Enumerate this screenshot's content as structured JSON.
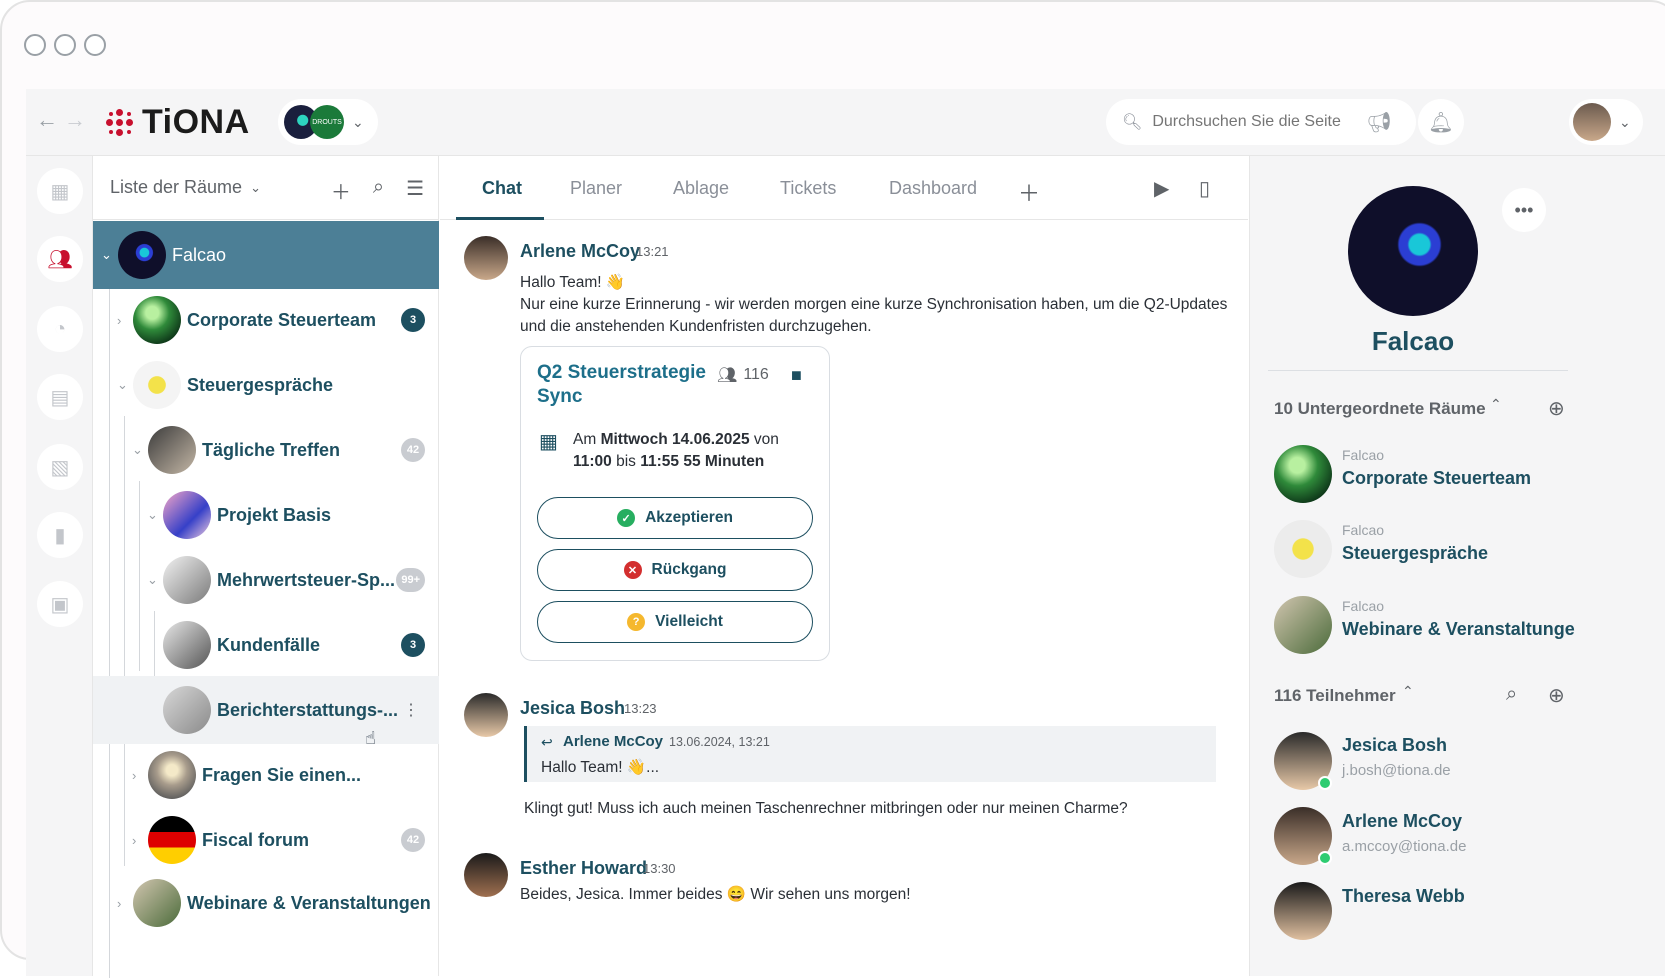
{
  "app": {
    "logo": "TiONA",
    "org_badge": "DROUTS"
  },
  "search": {
    "placeholder": "Durchsuchen Sie die Seite"
  },
  "roomlist": {
    "title": "Liste der Räume",
    "rooms": [
      {
        "name": "Falcao",
        "badge": ""
      },
      {
        "name": "Corporate Steuerteam",
        "badge": "3"
      },
      {
        "name": "Steuergespräche",
        "badge": ""
      },
      {
        "name": "Tägliche Treffen",
        "badge": "42"
      },
      {
        "name": "Projekt Basis",
        "badge": ""
      },
      {
        "name": "Mehrwertsteuer-Sp...",
        "badge": "99+"
      },
      {
        "name": "Kundenfälle",
        "badge": "3"
      },
      {
        "name": "Berichterstattungs-...",
        "badge": ""
      },
      {
        "name": "Fragen Sie einen...",
        "badge": ""
      },
      {
        "name": "Fiscal forum",
        "badge": "42"
      },
      {
        "name": "Webinare & Veranstaltungen",
        "badge": ""
      }
    ]
  },
  "tabs": [
    "Chat",
    "Planer",
    "Ablage",
    "Tickets",
    "Dashboard"
  ],
  "messages": {
    "m1": {
      "author": "Arlene McCoy",
      "time": "13:21",
      "line1": "Hallo Team! 👋",
      "line2": "Nur eine kurze Erinnerung - wir werden morgen eine kurze Synchronisation haben, um die Q2-Updates",
      "line3": "und die anstehenden Kundenfristen durchzugehen."
    },
    "event": {
      "title": "Q2 Steuerstrategie Sync",
      "count": "116",
      "prefix": "Am ",
      "date": "Mittwoch 14.06.2025",
      "von": " von",
      "start": "11:00",
      "bis": " bis ",
      "end": "11:55 55 Minuten",
      "accept": "Akzeptieren",
      "decline": "Rückgang",
      "maybe": "Vielleicht"
    },
    "m2": {
      "author": "Jesica Bosh",
      "time": "13:23",
      "quote_author": "Arlene McCoy",
      "quote_time": "13.06.2024, 13:21",
      "quote_text": "Hallo Team! 👋...",
      "text": "Klingt gut! Muss ich auch meinen Taschenrechner mitbringen oder nur meinen Charme?"
    },
    "m3": {
      "author": "Esther Howard",
      "time": "13:30",
      "text": "Beides, Jesica. Immer beides 😄 Wir sehen uns morgen!"
    }
  },
  "panel": {
    "room_name": "Falcao",
    "subrooms_title": "10 Untergeordnete Räume",
    "subrooms": [
      {
        "parent": "Falcao",
        "name": "Corporate Steuerteam"
      },
      {
        "parent": "Falcao",
        "name": "Steuergespräche"
      },
      {
        "parent": "Falcao",
        "name": "Webinare & Veranstaltunge"
      }
    ],
    "members_title": "116 Teilnehmer",
    "members": [
      {
        "name": "Jesica Bosh",
        "email": "j.bosh@tiona.de"
      },
      {
        "name": "Arlene McCoy",
        "email": "a.mccoy@tiona.de"
      },
      {
        "name": "Theresa Webb",
        "email": ""
      }
    ]
  }
}
